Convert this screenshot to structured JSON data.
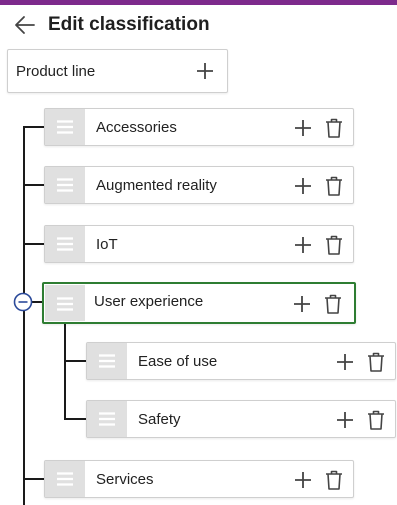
{
  "header": {
    "title": "Edit classification",
    "accent_color": "#7d2a8c"
  },
  "root": {
    "label": "Product line"
  },
  "nodes": [
    {
      "label": "Accessories"
    },
    {
      "label": "Augmented reality"
    },
    {
      "label": "IoT"
    },
    {
      "label": "User experience",
      "selected": true,
      "expanded": true
    },
    {
      "label": "Ease of use"
    },
    {
      "label": "Safety"
    },
    {
      "label": "Services"
    }
  ],
  "icons": {
    "back": "arrow-left-icon",
    "add": "plus-icon",
    "delete": "trash-icon",
    "drag": "drag-handle-icon",
    "collapse": "minus-circle-icon"
  },
  "colors": {
    "selected_border": "#2e7d32",
    "collapse_icon": "#2b4a9a"
  }
}
